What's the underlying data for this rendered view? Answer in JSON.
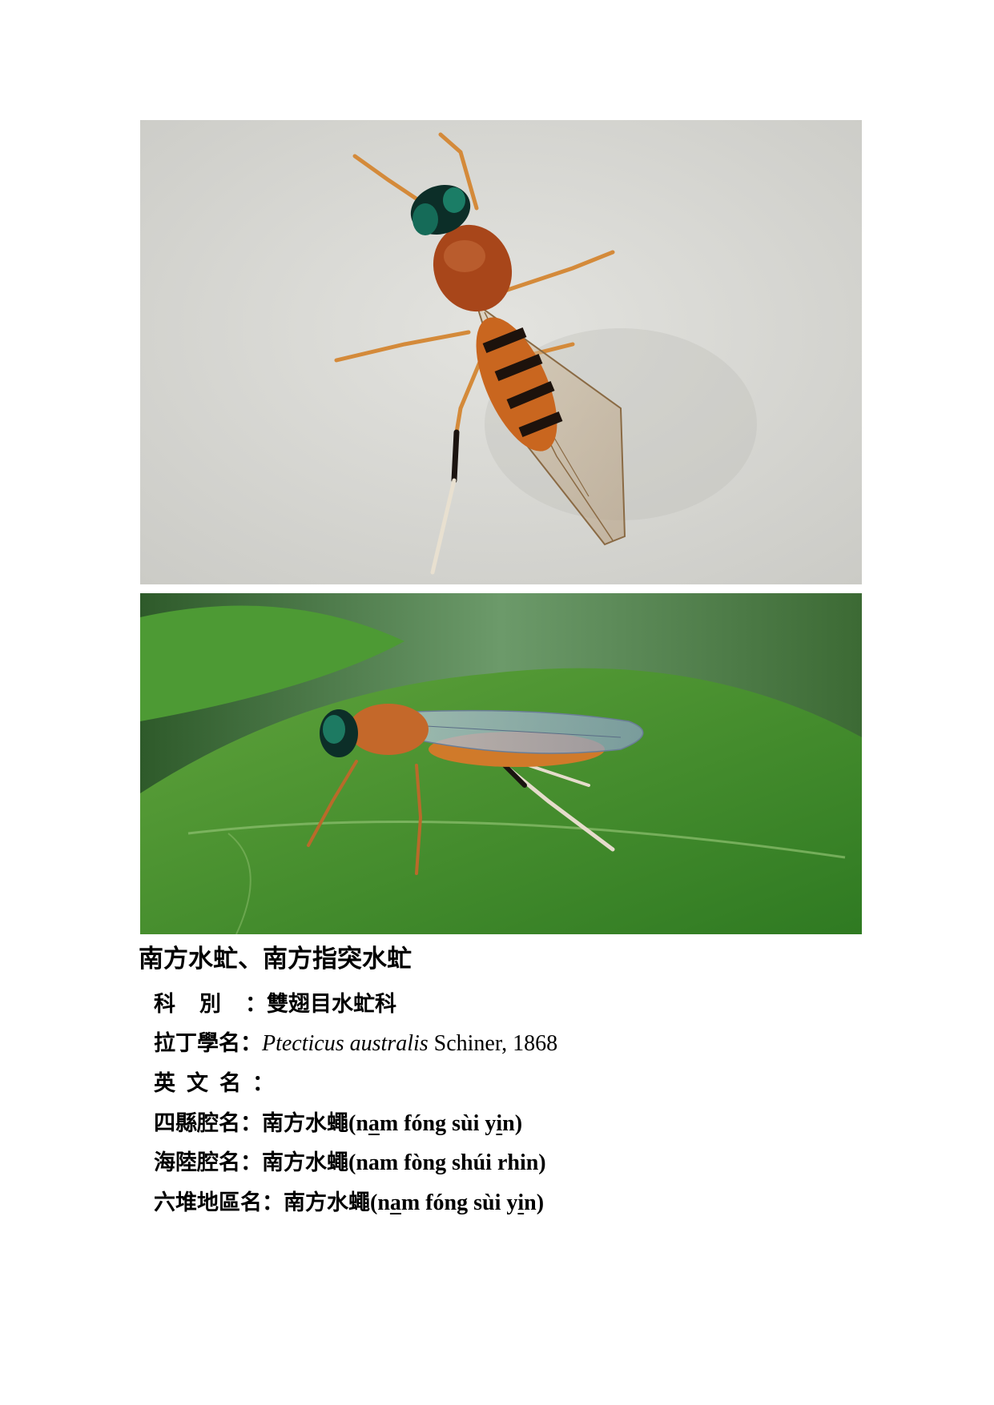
{
  "images": {
    "top": {
      "name": "soldier-fly-top-view-photo"
    },
    "bottom": {
      "name": "soldier-fly-side-view-photo"
    }
  },
  "title": "南方水虻、南方指突水虻",
  "info": {
    "family": {
      "label": "科別：",
      "value": "雙翅目水虻科"
    },
    "latin": {
      "label": "拉丁學名：",
      "genus_species": "Ptecticus australis",
      "author_year": "Schiner, 1868"
    },
    "english": {
      "label": "英文名：",
      "value": ""
    },
    "sixian": {
      "label": "四縣腔名：",
      "han": "南方水蠅",
      "rom_open": "(n",
      "rom_u1": "a",
      "rom_mid": "m fóng sùi y",
      "rom_u2": "i",
      "rom_close": "n)"
    },
    "hailu": {
      "label": "海陸腔名：",
      "han": "南方水蠅",
      "roman": "(nam fòng shúi rhin)"
    },
    "liudui": {
      "label": "六堆地區名：",
      "han": "南方水蠅",
      "rom_open": "(n",
      "rom_u1": "a",
      "rom_mid": "m fóng sùi y",
      "rom_u2": "i",
      "rom_close": "n)"
    }
  },
  "colors": {
    "wall": "#d9d9d4",
    "leaf": "#3f8a2a",
    "fly_body": "#a8461a",
    "fly_stripe": "#1d120c",
    "eye": "#0f5a4a"
  }
}
